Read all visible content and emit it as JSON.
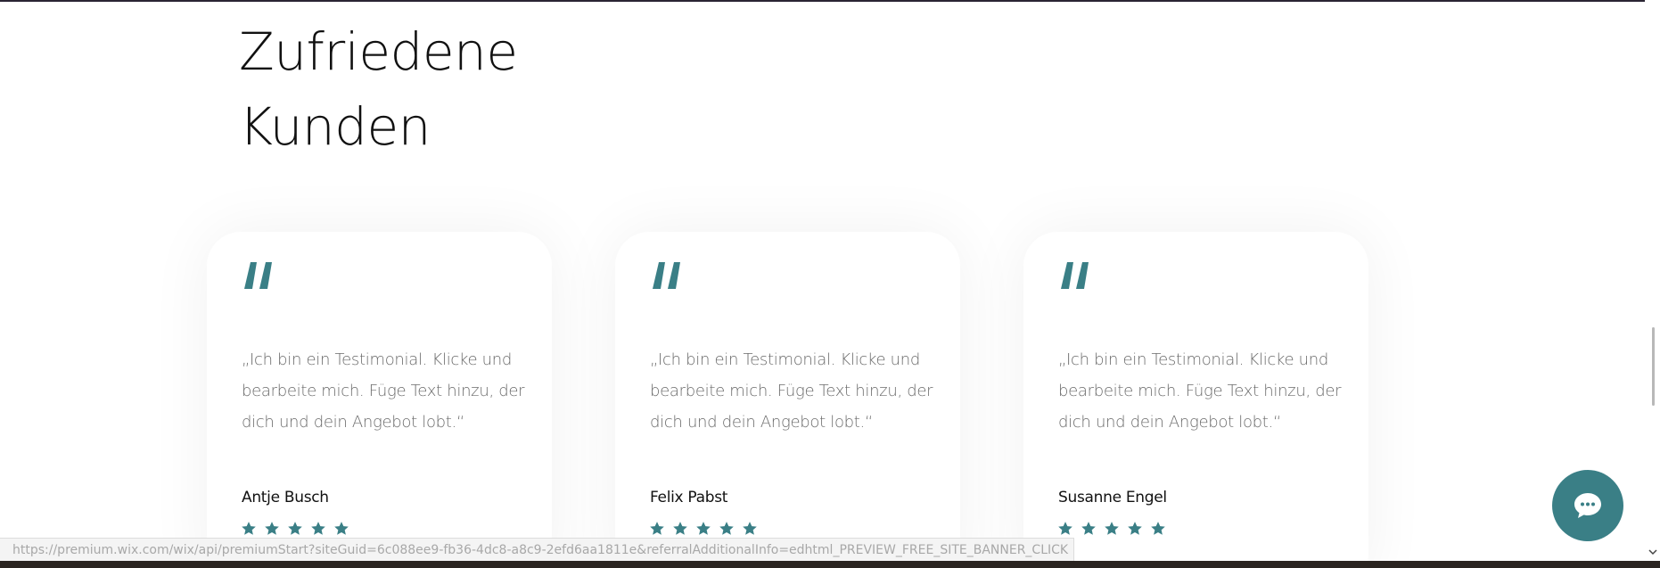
{
  "section": {
    "title_line1": "Zufriedene",
    "title_line2": "Kunden"
  },
  "testimonials": [
    {
      "quote": "„Ich bin ein Testimonial. Klicke und bearbeite mich. Füge Text hinzu, der dich und dein Angebot lobt.“",
      "author": "Antje Busch",
      "rating": 5
    },
    {
      "quote": "„Ich bin ein Testimonial. Klicke und bearbeite mich. Füge Text hinzu, der dich und dein Angebot lobt.“",
      "author": "Felix Pabst",
      "rating": 5
    },
    {
      "quote": "„Ich bin ein Testimonial. Klicke und bearbeite mich. Füge Text hinzu, der dich und dein Angebot lobt.“",
      "author": "Susanne Engel",
      "rating": 5
    }
  ],
  "icons": {
    "quote": "quote-icon",
    "star": "star-icon",
    "chat": "chat-bubble-icon",
    "scroll_down": "scroll-down-arrow-icon"
  },
  "colors": {
    "accent": "#3a7f86",
    "heading": "#111111",
    "body_text": "#6b6b6b"
  },
  "status_bar": {
    "url": "https://premium.wix.com/wix/api/premiumStart?siteGuid=6c088ee9-fb36-4dc8-a8c9-2efd6aa1811e&referralAdditionalInfo=edhtml_PREVIEW_FREE_SITE_BANNER_CLICK"
  }
}
